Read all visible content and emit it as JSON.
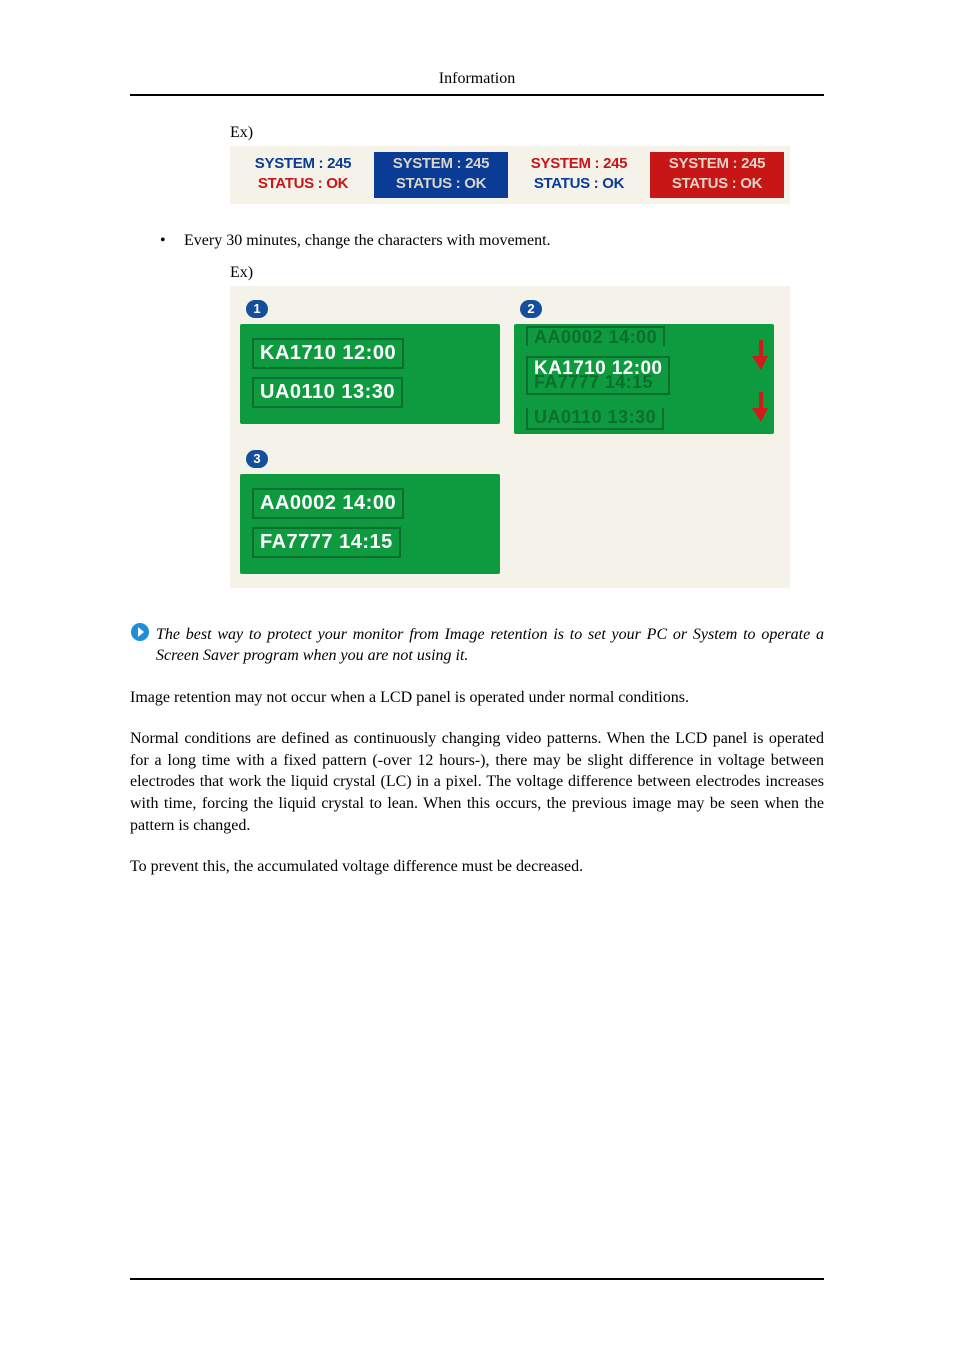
{
  "header": {
    "title": "Information"
  },
  "ex_label": "Ex)",
  "strip": {
    "tiles": [
      {
        "l1": "SYSTEM : 245",
        "l2": "STATUS : OK"
      },
      {
        "l1": "SYSTEM : 245",
        "l2": "STATUS : OK"
      },
      {
        "l1": "SYSTEM : 245",
        "l2": "STATUS : OK"
      },
      {
        "l1": "SYSTEM : 245",
        "l2": "STATUS : OK"
      }
    ]
  },
  "bullet": {
    "marker": "•",
    "text": "Every 30 minutes, change the characters with movement."
  },
  "panels": {
    "p1": {
      "num": "1",
      "lines": [
        "KA1710  12:00",
        "UA0110  13:30"
      ]
    },
    "p2": {
      "num": "2",
      "ghost_top": "AA0002  14:00",
      "mid_a": "KA1710  12:00",
      "mid_b": "FA7777  14:15",
      "ghost_bot": "UA0110  13:30"
    },
    "p3": {
      "num": "3",
      "lines": [
        "AA0002  14:00",
        "FA7777  14:15"
      ]
    }
  },
  "note": " The best way to protect your monitor from Image retention is to set your PC or System to operate a Screen Saver program when you are not using it.",
  "para1": "Image retention may not occur when a LCD panel is operated under normal conditions.",
  "para2": "Normal conditions are defined as continuously changing video patterns. When the LCD panel is operated for a long time with a fixed pattern (-over 12 hours-), there may be slight difference in voltage between electrodes that work the liquid crystal (LC) in a pixel. The voltage difference between electrodes increases with time, forcing the liquid crystal to lean. When this occurs, the previous image may be seen when the pattern is changed.",
  "para3": "To prevent this, the accumulated voltage difference must be decreased."
}
